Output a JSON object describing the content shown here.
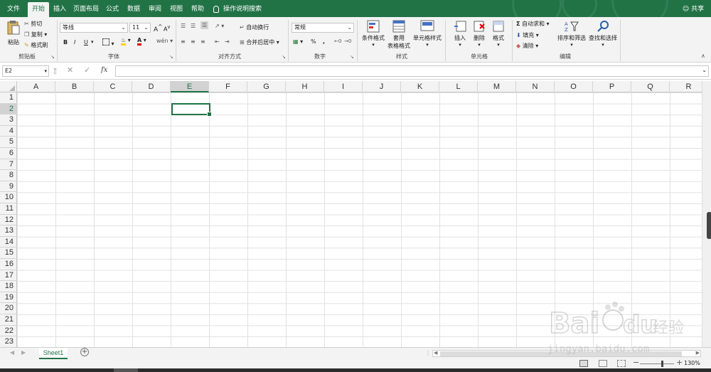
{
  "tabs": [
    "文件",
    "开始",
    "插入",
    "页面布局",
    "公式",
    "数据",
    "审阅",
    "视图",
    "帮助"
  ],
  "active_tab": "开始",
  "tell_me": "操作说明搜索",
  "share": "共享",
  "ribbon": {
    "clipboard": {
      "label": "剪贴板",
      "paste": "粘贴",
      "cut": "剪切",
      "copy": "复制",
      "format_painter": "格式刷"
    },
    "font": {
      "label": "字体",
      "name": "等线",
      "size": "11",
      "bold": "B",
      "italic": "I",
      "underline": "U",
      "grow": "A",
      "shrink": "A",
      "font_color": "A"
    },
    "alignment": {
      "label": "对齐方式",
      "wrap": "自动换行",
      "merge": "合并后居中"
    },
    "number": {
      "label": "数字",
      "format": "常规",
      "percent": "%",
      "comma": ","
    },
    "styles": {
      "label": "样式",
      "conditional": "条件格式",
      "table_line1": "套用",
      "table_line2": "表格格式",
      "cell_styles": "单元格样式"
    },
    "cells": {
      "label": "单元格",
      "insert": "插入",
      "delete": "删除",
      "format": "格式"
    },
    "editing": {
      "label": "编辑",
      "autosum": "自动求和",
      "fill": "填充",
      "clear": "清除",
      "sort": "排序和筛选",
      "find": "查找和选择"
    }
  },
  "formula_bar": {
    "name_box": "E2",
    "fx": "fx",
    "value": ""
  },
  "columns": [
    "A",
    "B",
    "C",
    "D",
    "E",
    "F",
    "G",
    "H",
    "I",
    "J",
    "K",
    "L",
    "M",
    "N",
    "O",
    "P",
    "Q",
    "R"
  ],
  "rows": [
    "1",
    "2",
    "3",
    "4",
    "5",
    "6",
    "7",
    "8",
    "9",
    "10",
    "11",
    "12",
    "13",
    "14",
    "15",
    "16",
    "17",
    "18",
    "19",
    "20",
    "21",
    "22",
    "23"
  ],
  "selected_column": "E",
  "selected_row": "2",
  "sheet_tab": "Sheet1",
  "zoom": "130%",
  "colors": {
    "accent": "#217346"
  }
}
